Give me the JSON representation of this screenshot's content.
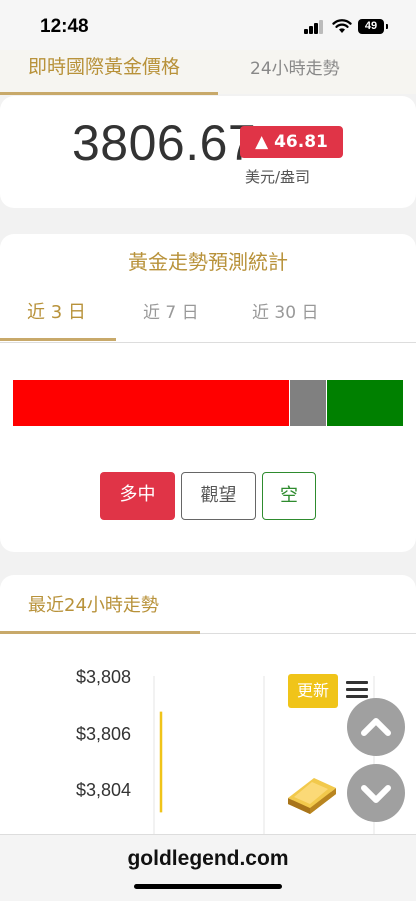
{
  "status_bar": {
    "time": "12:48",
    "battery": "49"
  },
  "top_tabs": [
    {
      "label": "即時國際黃金價格",
      "active": true
    },
    {
      "label": "24小時走勢",
      "active": false
    }
  ],
  "price": {
    "value": "3806.67",
    "change": "▲ 46.81",
    "unit": "美元/盎司",
    "change_color": "#e03447"
  },
  "prediction": {
    "title": "黃金走勢預測統計",
    "tabs": [
      {
        "label": "近 3 日",
        "active": true
      },
      {
        "label": "近 7 日",
        "active": false
      },
      {
        "label": "近 30 日",
        "active": false
      }
    ],
    "distribution": [
      {
        "key": "bull",
        "fraction": 0.71,
        "color": "#ff0000"
      },
      {
        "key": "neutral",
        "fraction": 0.095,
        "color": "#808080"
      },
      {
        "key": "bear",
        "fraction": 0.195,
        "color": "#008000"
      }
    ],
    "buttons": {
      "bull": "多中",
      "neutral": "觀望",
      "bear": "空"
    }
  },
  "chart": {
    "title": "最近24小時走勢",
    "refresh_label": "更新",
    "y_ticks": [
      "$3,808",
      "$3,806",
      "$3,804"
    ]
  },
  "chart_data": {
    "type": "line",
    "y_tick_labels": [
      "$3,808",
      "$3,806",
      "$3,804"
    ],
    "series": [
      {
        "values": [
          3803.2,
          3806.8
        ]
      }
    ],
    "ylim": [
      3803,
      3809
    ],
    "grid": true,
    "line_color": "#f0c419"
  },
  "footer": {
    "domain": "goldlegend.com"
  },
  "icons": [
    "signal-icon",
    "wifi-icon",
    "battery-icon",
    "menu-icon",
    "scroll-up-icon",
    "scroll-down-icon",
    "gold-bar-icon"
  ]
}
